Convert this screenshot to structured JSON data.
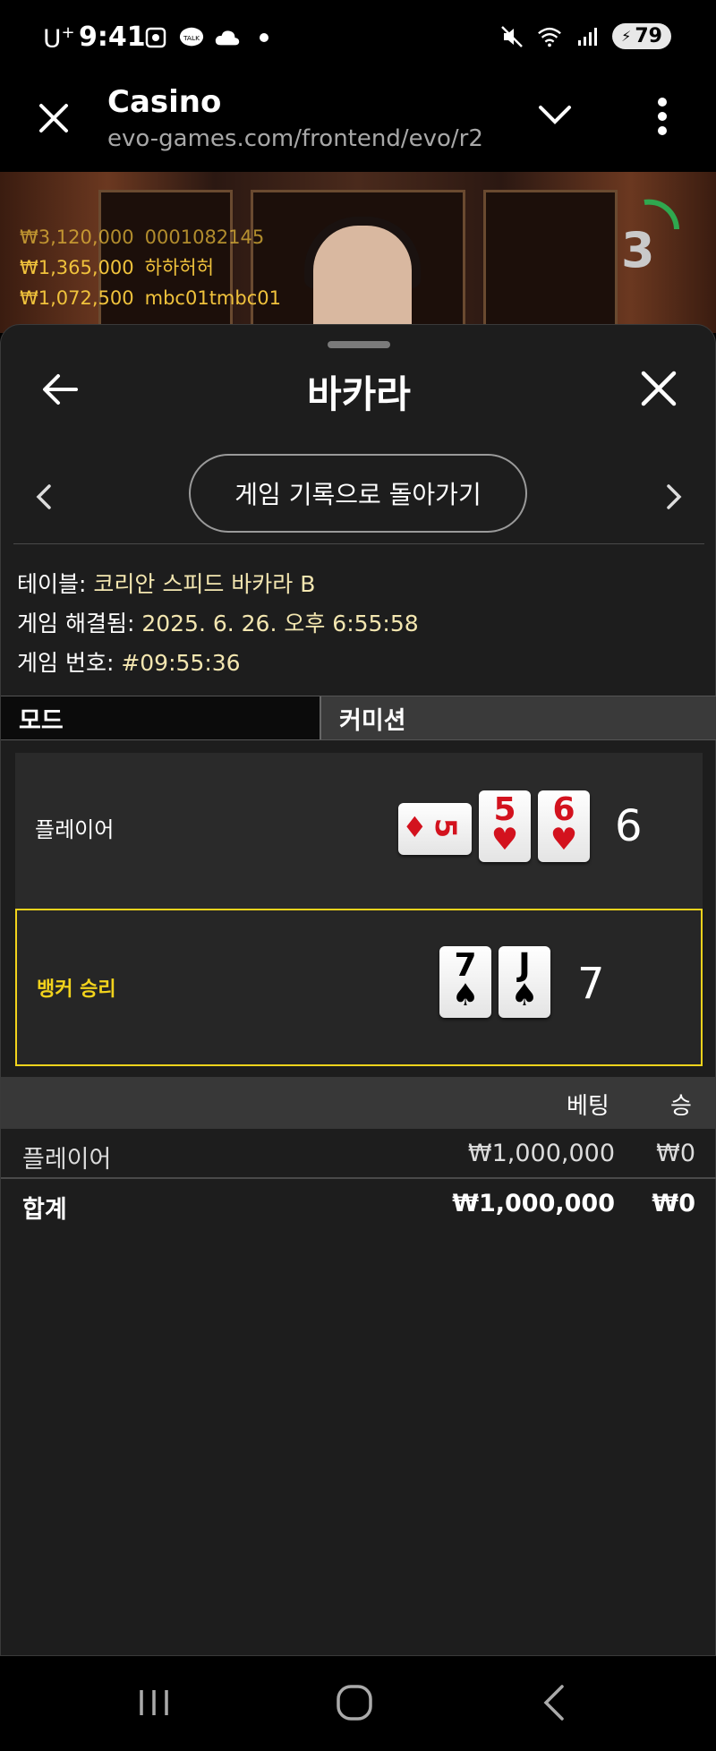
{
  "status_bar": {
    "carrier": "U",
    "carrier_sup": "+",
    "time": "9:41",
    "battery": "79",
    "icons": [
      "screenshot-icon",
      "kakaotalk-icon",
      "cloud-icon",
      "dot-icon",
      "mute-icon",
      "wifi-icon",
      "signal-icon",
      "battery-icon"
    ]
  },
  "browser": {
    "title": "Casino",
    "url": "evo-games.com/frontend/evo/r2"
  },
  "video": {
    "winners": [
      {
        "amount": "₩3,120,000",
        "name": "0001082145"
      },
      {
        "amount": "₩1,365,000",
        "name": "하하허허"
      },
      {
        "amount": "₩1,072,500",
        "name": "mbc01tmbc01"
      }
    ],
    "countdown": "3"
  },
  "sheet": {
    "title": "바카라",
    "back_to_history": "게임 기록으로 돌아가기",
    "info": {
      "table_label": "테이블: ",
      "table_value": "코리안 스피드 바카라 B",
      "resolved_label": "게임 해결됨: ",
      "resolved_value": "2025. 6. 26. 오후 6:55:58",
      "game_no_label": "게임 번호: ",
      "game_no_value": "#09:55:36"
    },
    "tabs": {
      "mode": "모드",
      "commission": "커미션"
    },
    "player": {
      "label": "플레이어",
      "score": "6",
      "cards": [
        {
          "rank": "5",
          "suit": "♦",
          "color": "#d3121e"
        },
        {
          "rank": "5",
          "suit": "♥",
          "color": "#d3121e"
        },
        {
          "rank": "6",
          "suit": "♥",
          "color": "#d3121e"
        }
      ]
    },
    "banker": {
      "label": "뱅커 승리",
      "score": "7",
      "cards": [
        {
          "rank": "7",
          "suit": "♠",
          "color": "#000000"
        },
        {
          "rank": "J",
          "suit": "♠",
          "color": "#000000"
        }
      ]
    },
    "bets": {
      "header_bet": "베팅",
      "header_win": "승",
      "rows": [
        {
          "name": "플레이어",
          "bet": "₩1,000,000",
          "win": "₩0"
        },
        {
          "name": "합계",
          "bet": "₩1,000,000",
          "win": "₩0"
        }
      ]
    }
  },
  "colors": {
    "winner_gold": "#f0c23c",
    "banker_yellow": "#f2d31c",
    "info_value": "#f3e6b0",
    "card_red": "#d3121e"
  }
}
